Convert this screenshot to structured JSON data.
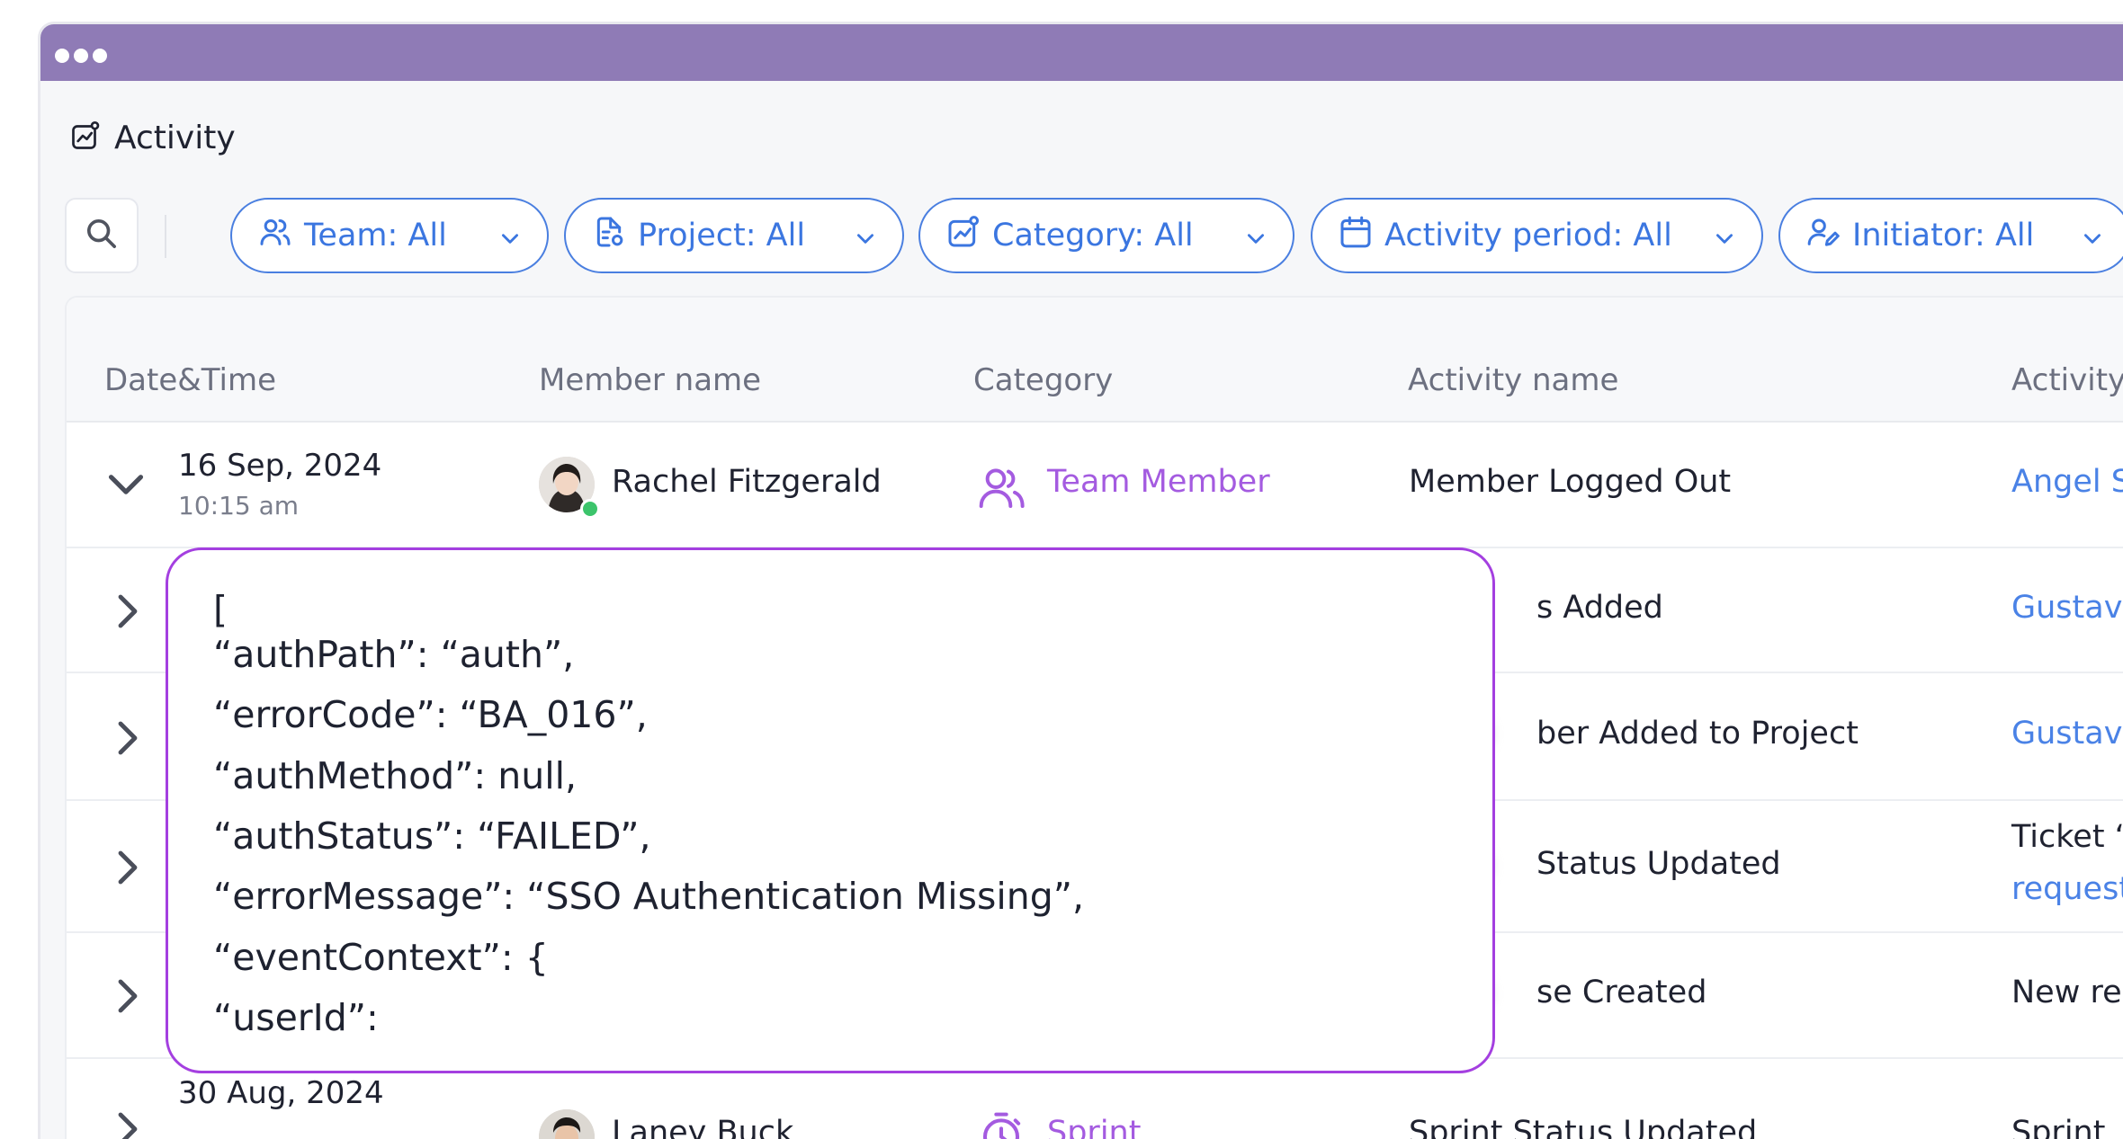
{
  "window": {
    "title": "Activity"
  },
  "filters": [
    {
      "label": "Team: All",
      "icon": "users-icon"
    },
    {
      "label": "Project: All",
      "icon": "project-file-icon"
    },
    {
      "label": "Category: All",
      "icon": "activity-chart-icon"
    },
    {
      "label": "Activity period: All",
      "icon": "calendar-icon"
    },
    {
      "label": "Initiator: All",
      "icon": "user-edit-icon"
    }
  ],
  "table": {
    "headers": [
      "Date&Time",
      "Member name",
      "Category",
      "Activity name",
      "Activity"
    ],
    "rows": [
      {
        "date": "16 Sep, 2024",
        "time": "10:15 am",
        "member": "Rachel Fitzgerald",
        "category": "Team Member",
        "activity": "Member Logged Out",
        "detail": "Angel S"
      },
      {
        "activity_visible": "s Added",
        "detail": "Gustav"
      },
      {
        "activity_visible": "ber Added to Project",
        "detail": "Gustav"
      },
      {
        "activity_visible": "Status Updated",
        "detail": "Ticket “",
        "detail2": "request"
      },
      {
        "activity_visible": "se Created",
        "detail": "New rel"
      },
      {
        "date": "30 Aug, 2024",
        "member": "Laney Buck",
        "category": "Sprint",
        "activity": "Sprint Status Updated",
        "detail": "Sprint"
      }
    ]
  },
  "json_popup": {
    "lines": [
      "[",
      "“authPath”: “auth”,",
      "“errorCode”: “BA_016”,",
      "“authMethod”: null,",
      "“authStatus”: “FAILED”,",
      "“errorMessage”: “SSO Authentication Missing”,",
      "“eventContext”: {",
      "“userId”:"
    ]
  },
  "colors": {
    "titlebar": "#8f7bb6",
    "accent_blue": "#3b76e0",
    "team_member_purple": "#a45be0",
    "popup_border": "#a43fe0"
  }
}
